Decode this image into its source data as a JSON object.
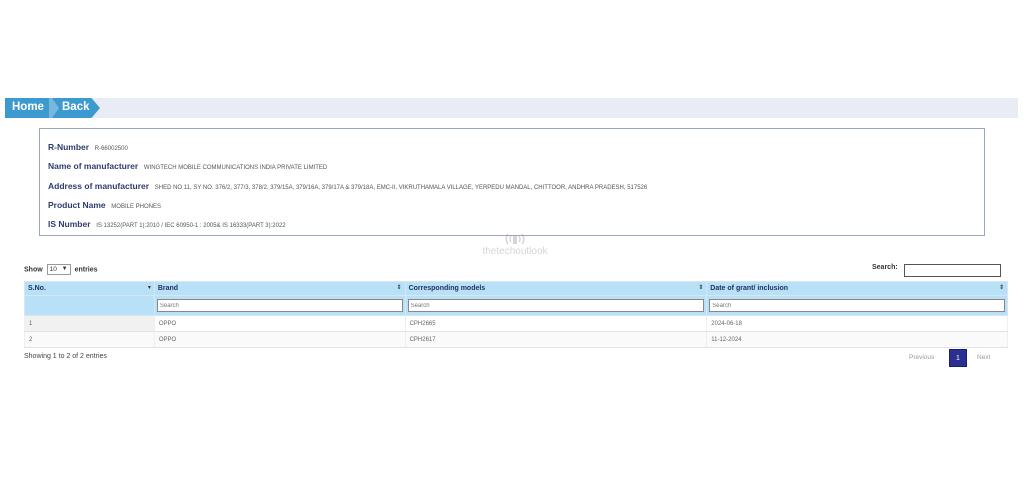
{
  "nav": {
    "home": "Home",
    "back": "Back"
  },
  "details": {
    "r_number_label": "R-Number",
    "r_number": "R-66002500",
    "manufacturer_label": "Name of manufacturer",
    "manufacturer": "WINGTECH MOBILE COMMUNICATIONS INDIA PRIVATE LIMITED",
    "address_label": "Address of manufacturer",
    "address": "SHED NO 11, SY NO. 376/2, 377/3, 378/2, 379/15A, 379/16A, 379/17A & 379/18A, EMC-II, VIKRUTHAMALA VILLAGE, YERPEDU MANDAL, CHITTOOR, ANDHRA PRADESH, 517526",
    "product_label": "Product Name",
    "product": "MOBILE PHONES",
    "is_label": "IS Number",
    "is_number": "IS 13252(PART 1):2010 / IEC 60950-1 : 2005& IS 16333(PART 3):2022"
  },
  "watermark": "thetechoutlook",
  "controls": {
    "show_label": "Show",
    "show_value": "10",
    "entries_label": "entries",
    "search_label": "Search:"
  },
  "table": {
    "headers": [
      "S.No.",
      "Brand",
      "Corresponding models",
      "Date of grant/ inclusion"
    ],
    "filter_placeholder": "Search",
    "rows": [
      [
        "1",
        "OPPO",
        "CPH2665",
        "2024-06-18"
      ],
      [
        "2",
        "OPPO",
        "CPH2617",
        "11-12-2024"
      ]
    ]
  },
  "footer": {
    "info": "Showing 1 to 2 of 2 entries",
    "previous": "Previous",
    "current_page": "1",
    "next": "Next"
  },
  "colors": {
    "nav_accent": "#3d9ad1",
    "table_header": "#b8e0f6",
    "label_text": "#2e3b6e",
    "page_current": "#2b2f8f"
  }
}
